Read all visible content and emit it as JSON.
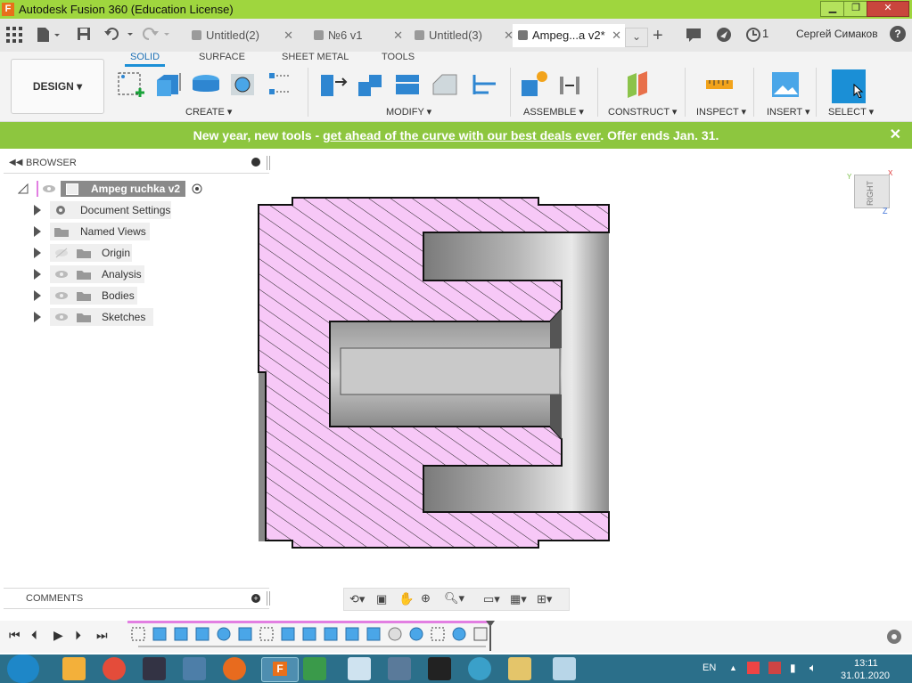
{
  "window": {
    "logo": "F",
    "title": "Autodesk Fusion 360 (Education License)",
    "min": "▁",
    "max": "❐",
    "close": "✕"
  },
  "tabs": [
    {
      "label": "Untitled(2)",
      "active": false
    },
    {
      "label": "№6 v1",
      "active": false
    },
    {
      "label": "Untitled(3)",
      "active": false
    },
    {
      "label": "Ampeg...a v2*",
      "active": true
    }
  ],
  "header": {
    "job_count": "1",
    "user": "Сергей Симаков",
    "help": "?"
  },
  "toolbar": {
    "workspace": "DESIGN ▾",
    "tabs": [
      "SOLID",
      "SURFACE",
      "SHEET METAL",
      "TOOLS"
    ],
    "groups": [
      "CREATE ▾",
      "MODIFY ▾",
      "ASSEMBLE ▾",
      "CONSTRUCT ▾",
      "INSPECT ▾",
      "INSERT ▾",
      "SELECT ▾"
    ]
  },
  "banner": {
    "lead": "New year, new tools - ",
    "link": "get ahead of the curve with our best deals ever",
    "tail": ". Offer ends Jan. 31.",
    "close": "✕"
  },
  "browser": {
    "title": "BROWSER",
    "root": "Ampeg ruchka v2",
    "items": [
      "Document Settings",
      "Named Views",
      "Origin",
      "Analysis",
      "Bodies",
      "Sketches"
    ]
  },
  "viewcube": {
    "face": "RIGHT",
    "axis_y": "Y",
    "axis_x": "X",
    "axis_z": "Z"
  },
  "comments": {
    "title": "COMMENTS"
  },
  "taskbar": {
    "lang": "EN",
    "time": "13:11",
    "date": "31.01.2020"
  },
  "colors": {
    "title_green": "#9fd63e",
    "banner_green": "#8dc63f",
    "section_fill": "#f7c8f7",
    "hatch": "#222222",
    "accent_blue": "#1b8fd6",
    "taskbar": "#2b6f8a"
  }
}
